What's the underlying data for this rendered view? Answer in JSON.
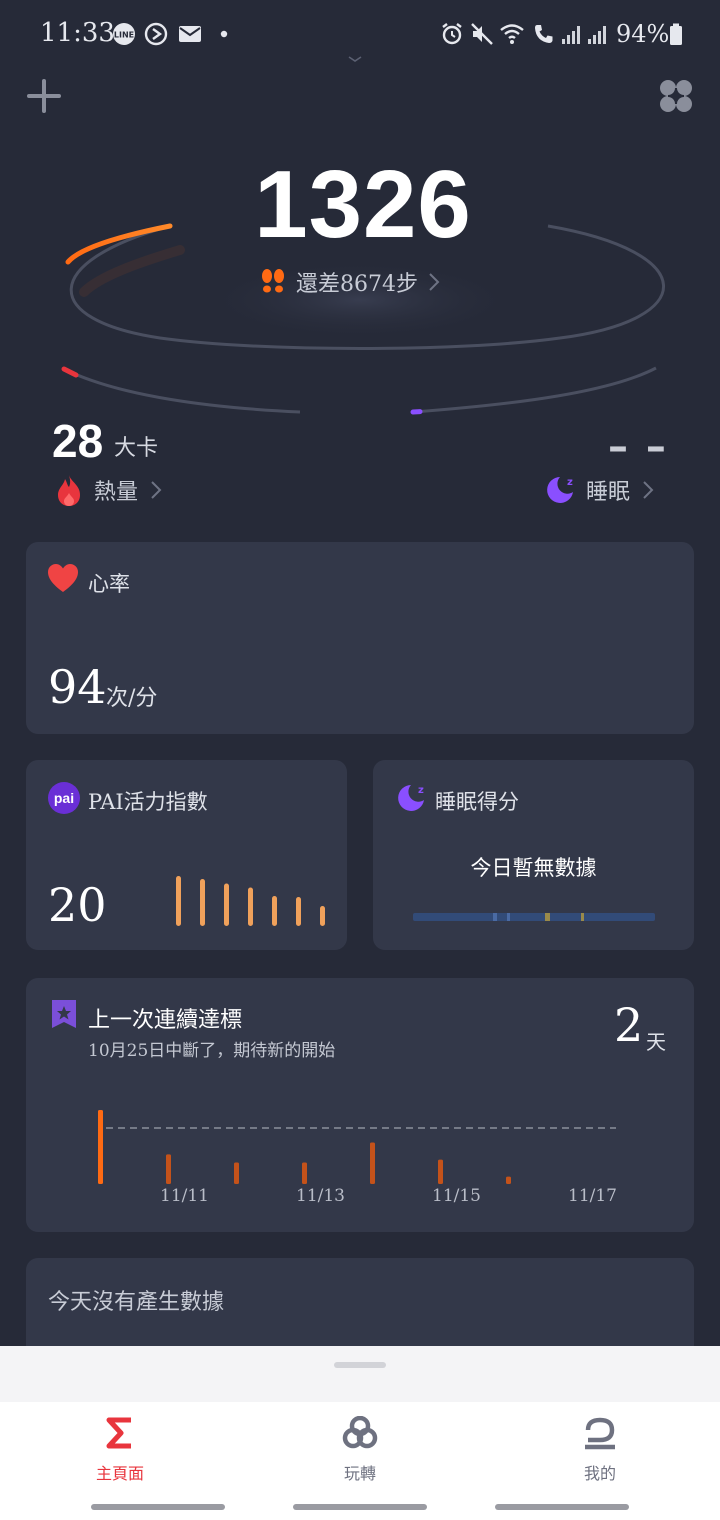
{
  "status_bar": {
    "time": "11:33",
    "battery": "94%",
    "icons": [
      "line-icon",
      "play-icon",
      "mail-icon",
      "dot-icon",
      "alarm-icon",
      "mute-icon",
      "wifi-icon",
      "call-icon",
      "signal-icon",
      "signal-icon",
      "battery-icon"
    ]
  },
  "header": {
    "add_icon": "plus-icon",
    "widgets_icon": "grid-icon"
  },
  "steps": {
    "value": "1326",
    "remaining": "還差8674步",
    "goal_progress": 0.1326
  },
  "calories": {
    "value": "28",
    "unit": "大卡",
    "label": "熱量"
  },
  "sleep": {
    "value": "– –",
    "label": "睡眠"
  },
  "heart_rate": {
    "title": "心率",
    "value": "94",
    "unit": "次/分"
  },
  "pai": {
    "badge": "pai",
    "title": "PAI活力指數",
    "value": "20",
    "bars": [
      1.0,
      0.94,
      0.85,
      0.77,
      0.6,
      0.58,
      0.4
    ]
  },
  "sleep_score": {
    "title": "睡眠得分",
    "message": "今日暫無數據"
  },
  "streak": {
    "title": "上一次連續達標",
    "subtitle": "10月25日中斷了，期待新的開始",
    "value": "2",
    "unit": "天",
    "x_labels": [
      "11/11",
      "11/13",
      "11/15",
      "11/17"
    ],
    "bars": [
      1.0,
      0.4,
      0.29,
      0.29,
      0.56,
      0.33,
      0.1
    ]
  },
  "today": {
    "message": "今天沒有產生數據"
  },
  "nav": {
    "home": "主頁面",
    "discover": "玩轉",
    "profile": "我的"
  },
  "colors": {
    "accent_orange": "#ff6a13",
    "accent_red": "#e8353d",
    "accent_purple": "#8a4fff",
    "pai_bar": "#f0a15b",
    "heart_wave": "#d94e94",
    "nav_active": "#e8353d"
  }
}
